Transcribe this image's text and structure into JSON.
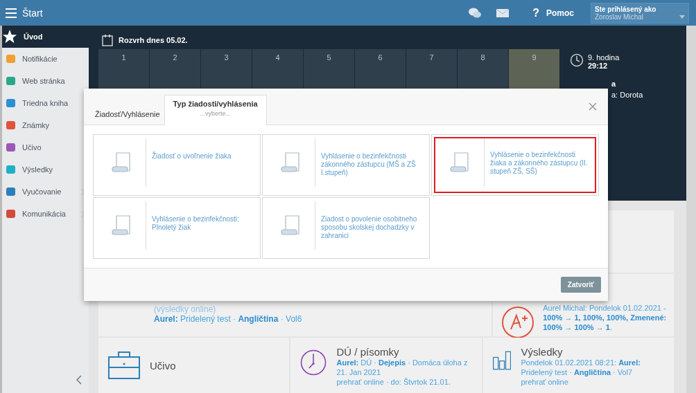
{
  "top_bar": {
    "title": "Štart",
    "help_icon": "?",
    "help": "Pomoc",
    "user_label": "Ste prihlásený ako",
    "user_name": "Zoroslav Michal"
  },
  "sidebar": {
    "items": [
      {
        "label": "Úvod",
        "selected": true,
        "has_submenu": false
      },
      {
        "label": "Notifikácie",
        "selected": false,
        "has_submenu": false
      },
      {
        "label": "Web stránka",
        "selected": false,
        "has_submenu": false
      },
      {
        "label": "Triedna kniha",
        "selected": false,
        "has_submenu": false
      },
      {
        "label": "Známky",
        "selected": false,
        "has_submenu": false
      },
      {
        "label": "Učivo",
        "selected": false,
        "has_submenu": false
      },
      {
        "label": "Výsledky",
        "selected": false,
        "has_submenu": false
      },
      {
        "label": "Vyučovanie",
        "selected": false,
        "has_submenu": true
      },
      {
        "label": "Komunikácia",
        "selected": false,
        "has_submenu": true
      }
    ]
  },
  "schedule": {
    "title": "Rozvrh dnes 05.02.",
    "periods": [
      {
        "label": "1",
        "current": false
      },
      {
        "label": "2",
        "current": false
      },
      {
        "label": "3",
        "current": false
      },
      {
        "label": "4",
        "current": false
      },
      {
        "label": "5",
        "current": false
      },
      {
        "label": "6",
        "current": false
      },
      {
        "label": "7",
        "current": false
      },
      {
        "label": "8",
        "current": false
      },
      {
        "label": "9",
        "current": true
      }
    ],
    "current_label": "9. hodina",
    "countdown": "29:12",
    "line_3": "a",
    "line_4": "a: Dorota"
  },
  "cards": {
    "results_online": "(výsledky online)",
    "test_line": "**Aurel:** Pridelený test · **Angličtina** · Vol6",
    "grades_text": "Aurel Michal: Pondelok 01.02.2021 - **100% → 1, 100%, 100%, Zmenené: 100% → 100% → 1**.",
    "bottom": [
      {
        "kind": "subject",
        "title": "Učivo"
      },
      {
        "kind": "homework",
        "title": "DÚ / písomky",
        "lines": [
          "**Aurel:** DÚ · **Dejepis** · Domáca úloha z 21. Jan 2021",
          "prehrať online · do: Štvrtok 21.01."
        ]
      },
      {
        "kind": "results",
        "title": "Výsledky",
        "lines": [
          "Pondelok 01.02.2021 08:21: **Aurel:** Pridelený test · **Angličtina** · Vol7",
          "prehrať online"
        ]
      }
    ]
  },
  "dialog": {
    "tabs": [
      {
        "label": "Žiadosť/Vyhlásenie",
        "selected": false
      },
      {
        "label": "Typ žiadosti/vyhlásenia",
        "sublabel": "...vyberte...",
        "selected": true
      }
    ],
    "tiles": [
      {
        "label": "Žiadosť o uvoľnenie žiaka",
        "selected": false
      },
      {
        "label": "Vyhlásenie o bezinfekčnosti zákonného zástupcu (MŠ a ZŠ I.stupeň)",
        "selected": false
      },
      {
        "label": "Vyhlásenie o bezinfekčnosti žiaka a zákonného zástupcu (II. stupeň ZŠ, SŠ)",
        "selected": true
      },
      {
        "label": "Vyhlásenie o bezinfekčnosti: Plnoletý žiak",
        "selected": false
      },
      {
        "label": "Ziadost o povolenie osobitneho sposobu skolskej dochadzky v zahranici",
        "selected": false
      }
    ],
    "close_button": "Zatvoriť"
  }
}
